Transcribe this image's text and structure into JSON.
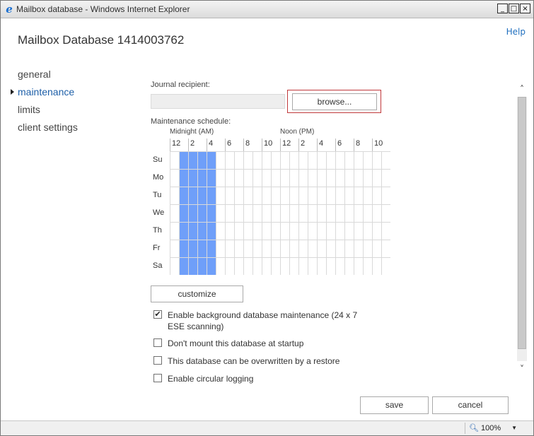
{
  "window": {
    "title": "Mailbox database - Windows Internet Explorer",
    "controls": [
      "_",
      "□",
      "×"
    ]
  },
  "help_label": "Help",
  "page_title": "Mailbox Database 1414003762",
  "nav": {
    "items": [
      {
        "label": "general",
        "active": false
      },
      {
        "label": "maintenance",
        "active": true
      },
      {
        "label": "limits",
        "active": false
      },
      {
        "label": "client settings",
        "active": false
      }
    ]
  },
  "journal": {
    "label": "Journal recipient:",
    "value": "",
    "browse_label": "browse..."
  },
  "schedule": {
    "label": "Maintenance schedule:",
    "am_label": "Midnight (AM)",
    "pm_label": "Noon (PM)",
    "hour_labels": [
      "12",
      "2",
      "4",
      "6",
      "8",
      "10",
      "12",
      "2",
      "4",
      "6",
      "8",
      "10"
    ],
    "days": [
      "Su",
      "Mo",
      "Tu",
      "We",
      "Th",
      "Fr",
      "Sa"
    ],
    "selected_hours": [
      1,
      2,
      3,
      4
    ],
    "selected_color": "#6f9ff9",
    "grid_color": "#d9d9d9"
  },
  "customize_label": "customize",
  "options": [
    {
      "label": "Enable background database maintenance (24 x 7 ESE scanning)",
      "checked": true
    },
    {
      "label": "Don't mount this database at startup",
      "checked": false
    },
    {
      "label": "This database can be overwritten by a restore",
      "checked": false
    },
    {
      "label": "Enable circular logging",
      "checked": false
    }
  ],
  "buttons": {
    "save": "save",
    "cancel": "cancel"
  },
  "statusbar": {
    "zoom": "100%"
  },
  "icons": {
    "browser": "ie-icon",
    "scroll_up": "chevron-up-icon",
    "scroll_down": "chevron-down-icon",
    "zoom": "magnifier-icon",
    "nav_selected": "caret-right-icon"
  }
}
